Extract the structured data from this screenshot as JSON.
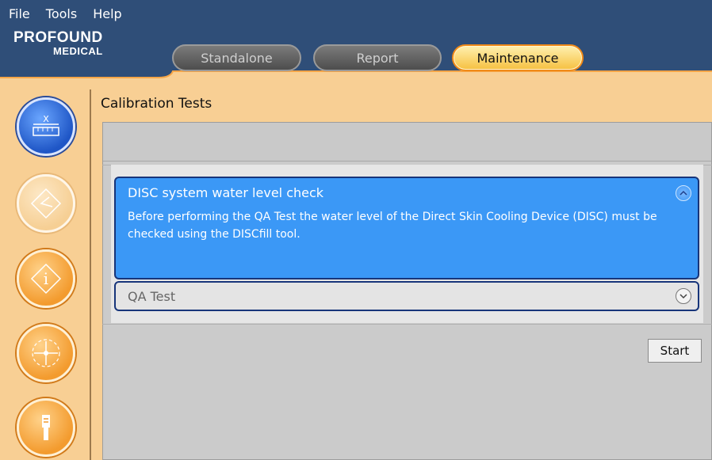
{
  "menu": {
    "file": "File",
    "tools": "Tools",
    "help": "Help"
  },
  "logo": {
    "line1": "PROFOUND",
    "line2": "MEDICAL"
  },
  "tabs": [
    {
      "label": "Standalone",
      "state": "inactive"
    },
    {
      "label": "Report",
      "state": "inactive"
    },
    {
      "label": "Maintenance",
      "state": "active"
    }
  ],
  "nav": [
    {
      "icon": "calibration-ruler-icon",
      "state": "selected"
    },
    {
      "icon": "diamond-arrow-icon",
      "state": "disabled"
    },
    {
      "icon": "info-icon",
      "state": "enabled"
    },
    {
      "icon": "position-crosshair-icon",
      "state": "enabled"
    },
    {
      "icon": "tool-device-icon",
      "state": "enabled"
    }
  ],
  "main": {
    "title": "Calibration Tests",
    "cards": [
      {
        "title": "DISC system water level check",
        "body": "Before performing the QA Test the water level of the Direct Skin Cooling Device (DISC) must be checked using the DISCfill tool.",
        "expanded": true
      },
      {
        "title": "QA Test",
        "expanded": false
      }
    ],
    "start_label": "Start"
  },
  "colors": {
    "topbar": "#2f4e78",
    "background": "#f8cf94",
    "card_active": "#3b98f6",
    "tab_active": "#f6c040"
  }
}
